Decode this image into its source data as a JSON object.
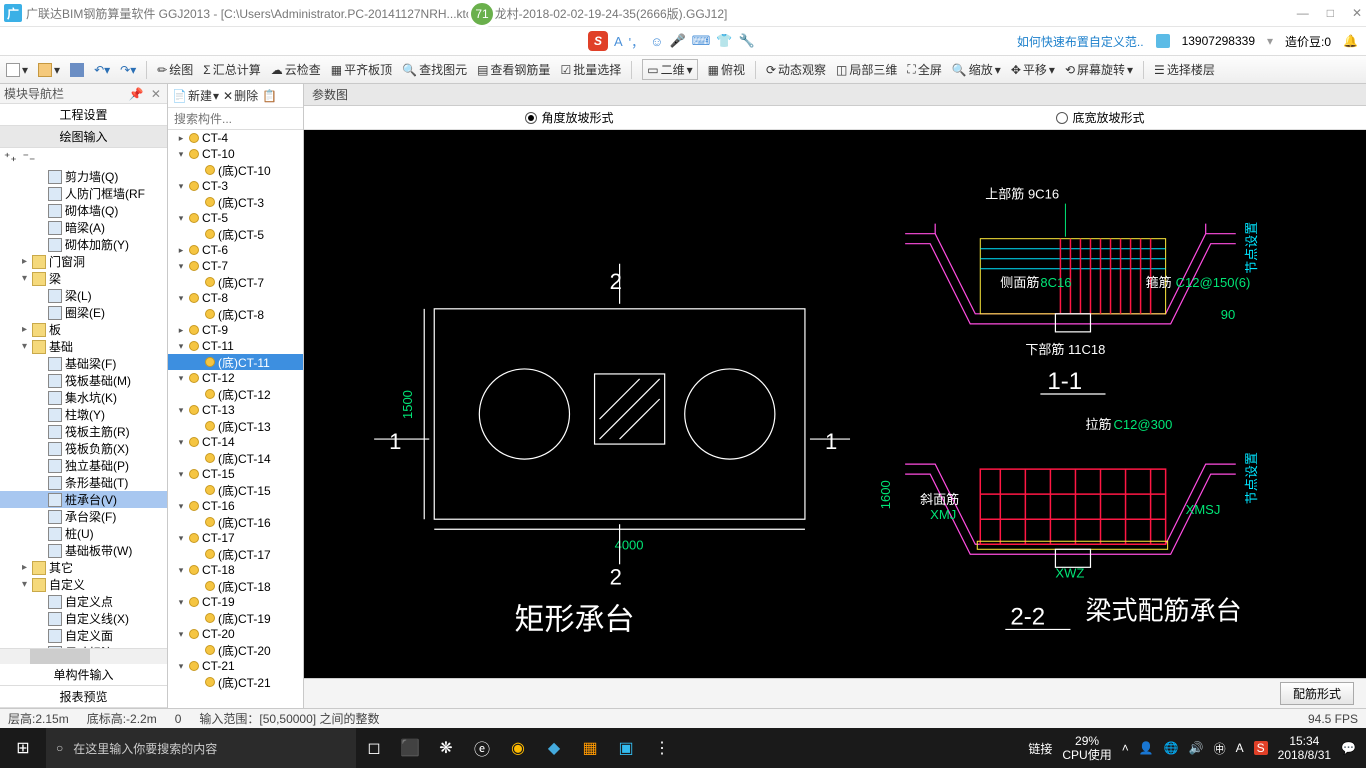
{
  "title": "广联达BIM钢筋算量软件 GGJ2013 - [C:\\Users\\Administrator.PC-20141127NRH...ktop\\白龙村-2018-02-02-19-24-35(2666版).GGJ12]",
  "badge": "71",
  "menubar": {
    "link": "如何快速布置自定义范..",
    "phone": "13907298339",
    "credit": "造价豆:0"
  },
  "toolbar": [
    "绘图",
    "汇总计算",
    "云检查",
    "平齐板顶",
    "查找图元",
    "查看钢筋量",
    "批量选择",
    "二维",
    "俯视",
    "动态观察",
    "局部三维",
    "全屏",
    "缩放",
    "平移",
    "屏幕旋转",
    "选择楼层"
  ],
  "leftPanel": {
    "title": "模块导航栏",
    "btns": [
      "工程设置",
      "绘图输入"
    ],
    "tree": [
      {
        "t": "剪力墙(Q)",
        "lv": 2
      },
      {
        "t": "人防门框墙(RF",
        "lv": 2
      },
      {
        "t": "砌体墙(Q)",
        "lv": 2
      },
      {
        "t": "暗梁(A)",
        "lv": 2
      },
      {
        "t": "砌体加筋(Y)",
        "lv": 2
      },
      {
        "t": "门窗洞",
        "lv": 1,
        "f": 1
      },
      {
        "t": "梁",
        "lv": 1,
        "f": 1,
        "o": 1
      },
      {
        "t": "梁(L)",
        "lv": 2
      },
      {
        "t": "圈梁(E)",
        "lv": 2
      },
      {
        "t": "板",
        "lv": 1,
        "f": 1
      },
      {
        "t": "基础",
        "lv": 1,
        "f": 1,
        "o": 1
      },
      {
        "t": "基础梁(F)",
        "lv": 2
      },
      {
        "t": "筏板基础(M)",
        "lv": 2
      },
      {
        "t": "集水坑(K)",
        "lv": 2
      },
      {
        "t": "柱墩(Y)",
        "lv": 2
      },
      {
        "t": "筏板主筋(R)",
        "lv": 2
      },
      {
        "t": "筏板负筋(X)",
        "lv": 2
      },
      {
        "t": "独立基础(P)",
        "lv": 2
      },
      {
        "t": "条形基础(T)",
        "lv": 2
      },
      {
        "t": "桩承台(V)",
        "lv": 2,
        "sel": 1
      },
      {
        "t": "承台梁(F)",
        "lv": 2
      },
      {
        "t": "桩(U)",
        "lv": 2
      },
      {
        "t": "基础板带(W)",
        "lv": 2
      },
      {
        "t": "其它",
        "lv": 1,
        "f": 1
      },
      {
        "t": "自定义",
        "lv": 1,
        "f": 1,
        "o": 1
      },
      {
        "t": "自定义点",
        "lv": 2
      },
      {
        "t": "自定义线(X)",
        "lv": 2
      },
      {
        "t": "自定义面",
        "lv": 2
      },
      {
        "t": "尺寸标注(W)",
        "lv": 2
      }
    ],
    "foot": [
      "单构件输入",
      "报表预览"
    ]
  },
  "midPanel": {
    "btns": [
      "新建",
      "删除"
    ],
    "search": "搜索构件...",
    "items": [
      {
        "t": "CT-4",
        "lv": 1
      },
      {
        "t": "CT-10",
        "lv": 1,
        "o": 1
      },
      {
        "t": "(底)CT-10",
        "lv": 2
      },
      {
        "t": "CT-3",
        "lv": 1,
        "o": 1
      },
      {
        "t": "(底)CT-3",
        "lv": 2
      },
      {
        "t": "CT-5",
        "lv": 1,
        "o": 1
      },
      {
        "t": "(底)CT-5",
        "lv": 2
      },
      {
        "t": "CT-6",
        "lv": 1
      },
      {
        "t": "CT-7",
        "lv": 1,
        "o": 1
      },
      {
        "t": "(底)CT-7",
        "lv": 2
      },
      {
        "t": "CT-8",
        "lv": 1,
        "o": 1
      },
      {
        "t": "(底)CT-8",
        "lv": 2
      },
      {
        "t": "CT-9",
        "lv": 1
      },
      {
        "t": "CT-11",
        "lv": 1,
        "o": 1
      },
      {
        "t": "(底)CT-11",
        "lv": 2,
        "sel": 1
      },
      {
        "t": "CT-12",
        "lv": 1,
        "o": 1
      },
      {
        "t": "(底)CT-12",
        "lv": 2
      },
      {
        "t": "CT-13",
        "lv": 1,
        "o": 1
      },
      {
        "t": "(底)CT-13",
        "lv": 2
      },
      {
        "t": "CT-14",
        "lv": 1,
        "o": 1
      },
      {
        "t": "(底)CT-14",
        "lv": 2
      },
      {
        "t": "CT-15",
        "lv": 1,
        "o": 1
      },
      {
        "t": "(底)CT-15",
        "lv": 2
      },
      {
        "t": "CT-16",
        "lv": 1,
        "o": 1
      },
      {
        "t": "(底)CT-16",
        "lv": 2
      },
      {
        "t": "CT-17",
        "lv": 1,
        "o": 1
      },
      {
        "t": "(底)CT-17",
        "lv": 2
      },
      {
        "t": "CT-18",
        "lv": 1,
        "o": 1
      },
      {
        "t": "(底)CT-18",
        "lv": 2
      },
      {
        "t": "CT-19",
        "lv": 1,
        "o": 1
      },
      {
        "t": "(底)CT-19",
        "lv": 2
      },
      {
        "t": "CT-20",
        "lv": 1,
        "o": 1
      },
      {
        "t": "(底)CT-20",
        "lv": 2
      },
      {
        "t": "CT-21",
        "lv": 1,
        "o": 1
      },
      {
        "t": "(底)CT-21",
        "lv": 2
      }
    ]
  },
  "paramHead": "参数图",
  "radios": {
    "r1": "角度放坡形式",
    "r2": "底宽放坡形式"
  },
  "canvas": {
    "plan": {
      "title": "矩形承台",
      "w": "4000",
      "h": "1500",
      "top": "2",
      "bot": "2",
      "left": "1",
      "right": "1"
    },
    "sec1": {
      "label": "1-1",
      "top": "上部筋  9C16",
      "side": "侧面筋",
      "sideVal": "8C16",
      "stirrup": "箍筋",
      "stirrupVal": "C12@150(6)",
      "bot": "下部筋  11C18",
      "ang": "90",
      "nd": "节点设置"
    },
    "sec2": {
      "label": "2-2",
      "title": "梁式配筋承台",
      "h": "1600",
      "tie": "拉筋",
      "tieVal": "C12@300",
      "slope": "斜面筋",
      "xmj": "XMJ",
      "xmsj": "XMSJ",
      "xwz": "XWZ",
      "nd": "节点设置"
    }
  },
  "footBtn": "配筋形式",
  "status": {
    "floor": "层高:2.15m",
    "base": "底标高:-2.2m",
    "zero": "0",
    "hint": "输入范围：[50,50000] 之间的整数",
    "fps": "94.5 FPS"
  },
  "taskbar": {
    "search": "在这里输入你要搜索的内容",
    "link": "链接",
    "cpu1": "29%",
    "cpu2": "CPU使用",
    "time": "15:34",
    "date": "2018/8/31"
  }
}
